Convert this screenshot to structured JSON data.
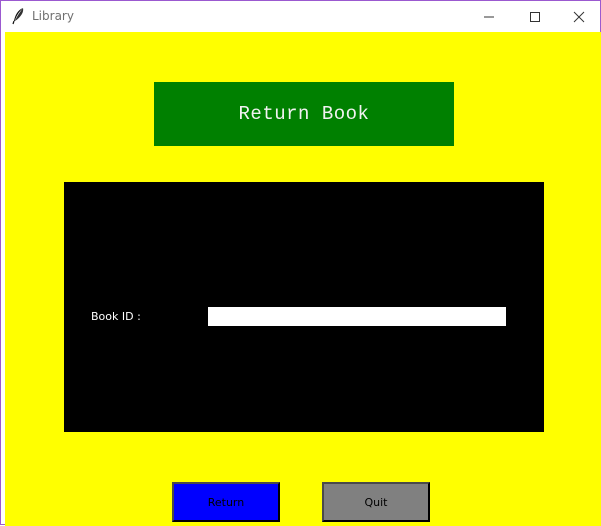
{
  "window": {
    "title": "Library",
    "icon": "feather-icon",
    "controls": [
      "minimize-icon",
      "maximize-icon",
      "close-icon"
    ]
  },
  "heading": {
    "text": "Return Book",
    "background": "#008000"
  },
  "form": {
    "book_id_label": "Book ID :",
    "book_id_value": "",
    "background": "#000000"
  },
  "buttons": {
    "return_label": "Return",
    "return_color": "#0000ff",
    "quit_label": "Quit",
    "quit_color": "#808080"
  },
  "theme": {
    "window_background": "#ffff00"
  }
}
